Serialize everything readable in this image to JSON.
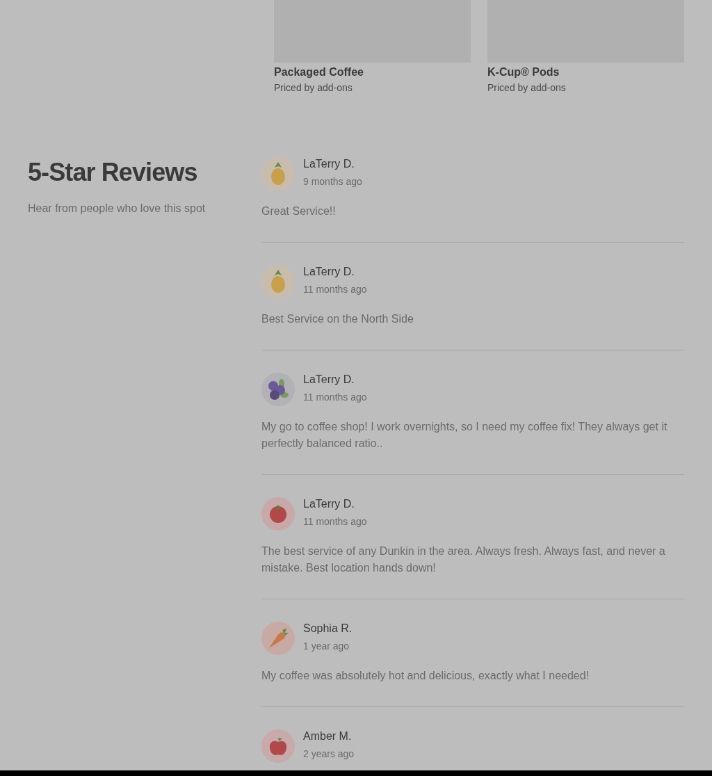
{
  "products": [
    {
      "name": "Packaged Coffee",
      "price": "Priced by add-ons"
    },
    {
      "name": "K-Cup® Pods",
      "price": "Priced by add-ons"
    }
  ],
  "reviews_section": {
    "title": "5-Star Reviews",
    "subtitle": "Hear from people who love this spot",
    "reviews": [
      {
        "author": "LaTerry D.",
        "time": "9 months ago",
        "kind": "pineapple",
        "text": "Great Service!!"
      },
      {
        "author": "LaTerry D.",
        "time": "11 months ago",
        "kind": "pineapple",
        "text": "Best Service on the North Side"
      },
      {
        "author": "LaTerry D.",
        "time": "11 months ago",
        "kind": "blueberry",
        "text": "My go to coffee shop! I work overnights, so I need my coffee fix! They always get it perfectly balanced ratio.."
      },
      {
        "author": "LaTerry D.",
        "time": "11 months ago",
        "kind": "tomato",
        "text": "The best service of any Dunkin in the area. Always fresh. Always fast, and never a mistake. Best location hands down!"
      },
      {
        "author": "Sophia R.",
        "time": "1 year ago",
        "kind": "carrot",
        "text": "My coffee was absolutely hot and delicious, exactly what I needed!"
      },
      {
        "author": "Amber M.",
        "time": "2 years ago",
        "kind": "apple"
      }
    ]
  }
}
